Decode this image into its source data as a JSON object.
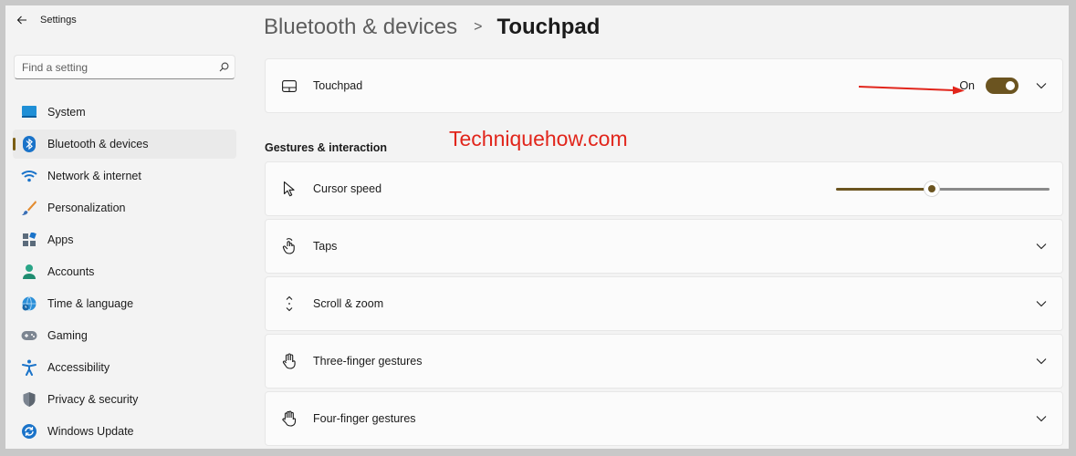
{
  "app": {
    "title": "Settings"
  },
  "search": {
    "placeholder": "Find a setting"
  },
  "sidebar": {
    "items": [
      {
        "label": "System",
        "icon": "monitor-icon"
      },
      {
        "label": "Bluetooth & devices",
        "icon": "bluetooth-icon",
        "active": true
      },
      {
        "label": "Network & internet",
        "icon": "wifi-icon"
      },
      {
        "label": "Personalization",
        "icon": "brush-icon"
      },
      {
        "label": "Apps",
        "icon": "apps-icon"
      },
      {
        "label": "Accounts",
        "icon": "person-icon"
      },
      {
        "label": "Time & language",
        "icon": "globe-clock-icon"
      },
      {
        "label": "Gaming",
        "icon": "gamepad-icon"
      },
      {
        "label": "Accessibility",
        "icon": "accessibility-icon"
      },
      {
        "label": "Privacy & security",
        "icon": "shield-icon"
      },
      {
        "label": "Windows Update",
        "icon": "update-icon"
      }
    ]
  },
  "breadcrumb": {
    "parent": "Bluetooth & devices",
    "separator": ">",
    "current": "Touchpad"
  },
  "touchpad": {
    "label": "Touchpad",
    "state_label": "On",
    "enabled": true
  },
  "section": {
    "title": "Gestures & interaction"
  },
  "watermark": {
    "text": "Techniquehow.com"
  },
  "cursor_speed": {
    "label": "Cursor speed",
    "value_fraction": 0.45
  },
  "settings": [
    {
      "label": "Taps",
      "icon": "tap-icon"
    },
    {
      "label": "Scroll & zoom",
      "icon": "scroll-icon"
    },
    {
      "label": "Three-finger gestures",
      "icon": "three-finger-icon"
    },
    {
      "label": "Four-finger gestures",
      "icon": "four-finger-icon"
    }
  ],
  "colors": {
    "accent": "#6b5420",
    "annotation": "#e1251b"
  }
}
